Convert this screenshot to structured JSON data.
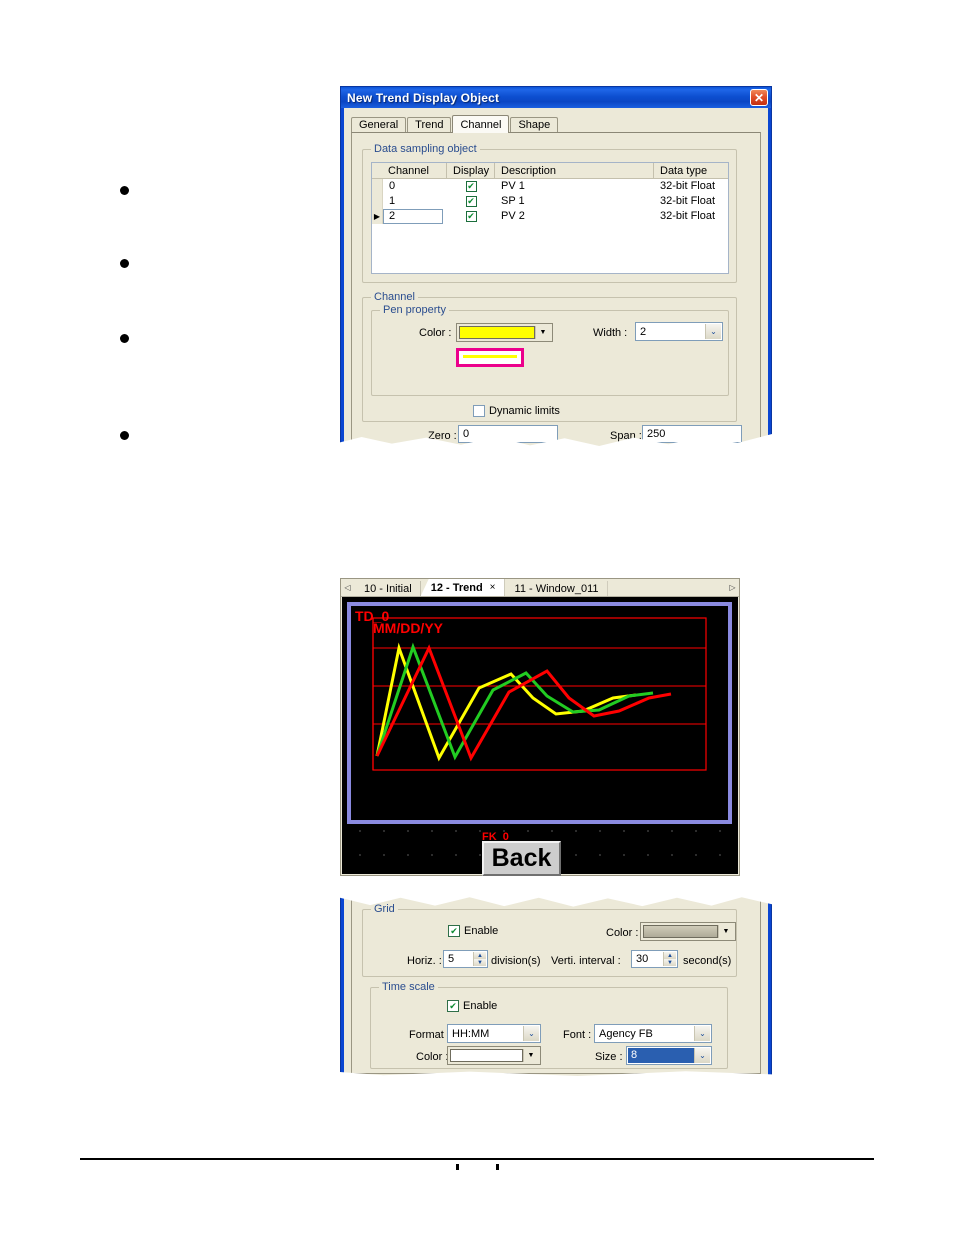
{
  "dialog": {
    "title": "New  Trend Display Object",
    "close_icon": "close-icon",
    "tabs": [
      {
        "label": "General",
        "active": false
      },
      {
        "label": "Trend",
        "active": false
      },
      {
        "label": "Channel",
        "active": true
      },
      {
        "label": "Shape",
        "active": false
      }
    ],
    "data_sampling": {
      "group_label": "Data sampling object",
      "columns": [
        "Channel",
        "Display",
        "Description",
        "Data type"
      ],
      "rows": [
        {
          "channel": "0",
          "display": true,
          "description": "PV 1",
          "data_type": "32-bit Float",
          "selected": false
        },
        {
          "channel": "1",
          "display": true,
          "description": "SP 1",
          "data_type": "32-bit Float",
          "selected": false
        },
        {
          "channel": "2",
          "display": true,
          "description": "PV 2",
          "data_type": "32-bit Float",
          "selected": true
        }
      ],
      "row_marker": "▶",
      "check_glyph": "✔"
    },
    "channel": {
      "group_label": "Channel",
      "pen_property": {
        "group_label": "Pen property",
        "color_label": "Color :",
        "color_value": "#ffff00",
        "color_arrow": "▼",
        "width_label": "Width :",
        "width_value": "2",
        "width_arrow": "⌄",
        "preview_border_color": "#ec008c",
        "preview_line_color": "#ffff00",
        "preview_bg": "#ffffff"
      },
      "dynamic_limits_label": "Dynamic limits",
      "dynamic_limits_checked": false,
      "zero_label": "Zero :",
      "zero_value": "0",
      "span_label": "Span :",
      "span_value": "250"
    }
  },
  "editor": {
    "nav_left_icon": "chevron-left-icon",
    "nav_right_icon": "chevron-right-icon",
    "nav_left_glyph": "◁",
    "nav_right_glyph": "▷",
    "tabs": [
      {
        "label": "10 - Initial",
        "active": false,
        "closable": false
      },
      {
        "label": "12 - Trend",
        "active": true,
        "closable": true
      },
      {
        "label": "11 - Window_011",
        "active": false,
        "closable": false
      }
    ],
    "tab_close_glyph": "×",
    "canvas": {
      "trend_object_label": "TD_0",
      "time_label": "MM/DD/YY",
      "label_color": "#ff0000",
      "frame_color": "#8a8ae0",
      "grid_color": "#ff0000",
      "button": {
        "tag_label": "FK_0",
        "caption": "Back"
      }
    }
  },
  "chart_data": {
    "type": "line",
    "title": "TD_0",
    "xlabel": "",
    "ylabel": "",
    "grid": true,
    "grid_color": "#ff0000",
    "legend": "none",
    "x": [
      0,
      1,
      2,
      3,
      4,
      5,
      6,
      7,
      8,
      9
    ],
    "ylim": [
      0,
      250
    ],
    "series": [
      {
        "name": "PV 1",
        "color": "#ffff00",
        "values": [
          18,
          188,
          36,
          112,
          160,
          132,
          98,
          96,
          120,
          126
        ]
      },
      {
        "name": "SP 1",
        "color": "#00cc00",
        "values": [
          20,
          186,
          40,
          110,
          164,
          128,
          100,
          98,
          118,
          124
        ]
      },
      {
        "name": "PV 2",
        "color": "#ff0000",
        "values": [
          22,
          184,
          44,
          106,
          168,
          126,
          102,
          96,
          116,
          128
        ]
      }
    ]
  },
  "settings_panel": {
    "grid": {
      "group_label": "Grid",
      "enable_label": "Enable",
      "enable_checked": true,
      "color_label": "Color :",
      "color_value": "#b9b5a2",
      "color_arrow": "▼",
      "horiz_label": "Horiz. :",
      "horiz_value": "5",
      "horiz_unit": "division(s)",
      "verti_label": "Verti. interval :",
      "verti_value": "30",
      "verti_unit": "second(s)"
    },
    "time_scale": {
      "group_label": "Time scale",
      "enable_label": "Enable",
      "enable_checked": true,
      "format_label": "Format :",
      "format_value": "HH:MM",
      "font_label": "Font :",
      "font_value": "Agency FB",
      "color_label": "Color :",
      "color_value": "#ffffff",
      "color_arrow": "▼",
      "size_label": "Size :",
      "size_value": "8",
      "combo_arrow": "⌄"
    }
  },
  "page": {
    "bullet_glyph": "•",
    "bullets": [
      1,
      2,
      3,
      4
    ]
  }
}
